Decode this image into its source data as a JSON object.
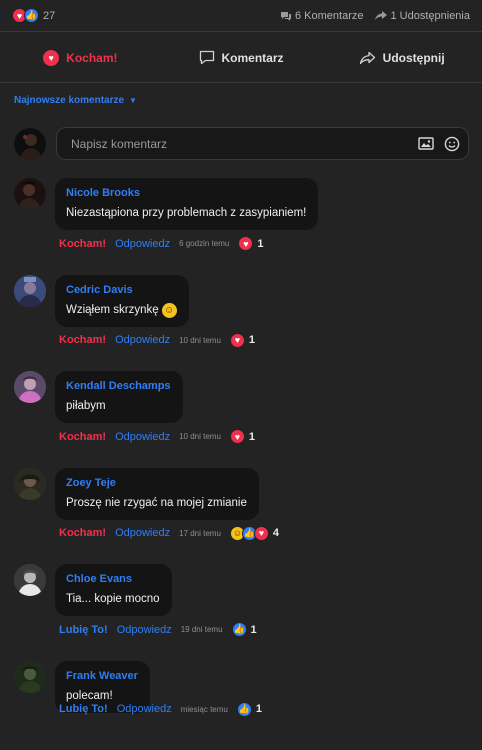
{
  "summary": {
    "reaction_count": "27",
    "comments_label": "6 Komentarze",
    "shares_label": "1 Udostępnienia"
  },
  "actions": {
    "love_label": "Kocham!",
    "comment_label": "Komentarz",
    "share_label": "Udostępnij"
  },
  "sort": {
    "label": "Najnowsze komentarze"
  },
  "composer": {
    "placeholder": "Napisz komentarz"
  },
  "colors": {
    "background": "#232323",
    "bubble": "#141414",
    "accent_blue": "#2f7ef5",
    "accent_red": "#f0314d"
  },
  "comments": [
    {
      "author": "Nicole Brooks",
      "text": "Niezastąpiona przy problemach z zasypianiem!",
      "reaction_label": "Kocham!",
      "reply_label": "Odpowiedz",
      "time": "6 godzin temu",
      "reactions": [
        "love"
      ],
      "count": "1"
    },
    {
      "author": "Cedric Davis",
      "text": "Wziąłem skrzynkę",
      "reaction_label": "Kocham!",
      "reply_label": "Odpowiedz",
      "time": "10 dni temu",
      "reactions": [
        "love"
      ],
      "count": "1"
    },
    {
      "author": "Kendall Deschamps",
      "text": "piłabym",
      "reaction_label": "Kocham!",
      "reply_label": "Odpowiedz",
      "time": "10 dni temu",
      "reactions": [
        "love"
      ],
      "count": "1"
    },
    {
      "author": "Zoey Teje",
      "text": "Proszę nie rzygać na mojej zmianie",
      "reaction_label": "Kocham!",
      "reply_label": "Odpowiedz",
      "time": "17 dni temu",
      "reactions": [
        "haha",
        "like",
        "love"
      ],
      "count": "4"
    },
    {
      "author": "Chloe Evans",
      "text": "Tia... kopie mocno",
      "reaction_label": "Lubię To!",
      "reply_label": "Odpowiedz",
      "time": "19 dni temu",
      "reactions": [
        "like"
      ],
      "count": "1"
    },
    {
      "author": "Frank Weaver",
      "text": "polecam!",
      "reaction_label": "Lubię To!",
      "reply_label": "Odpowiedz",
      "time": "miesiąc temu",
      "reactions": [
        "like"
      ],
      "count": "1"
    }
  ]
}
